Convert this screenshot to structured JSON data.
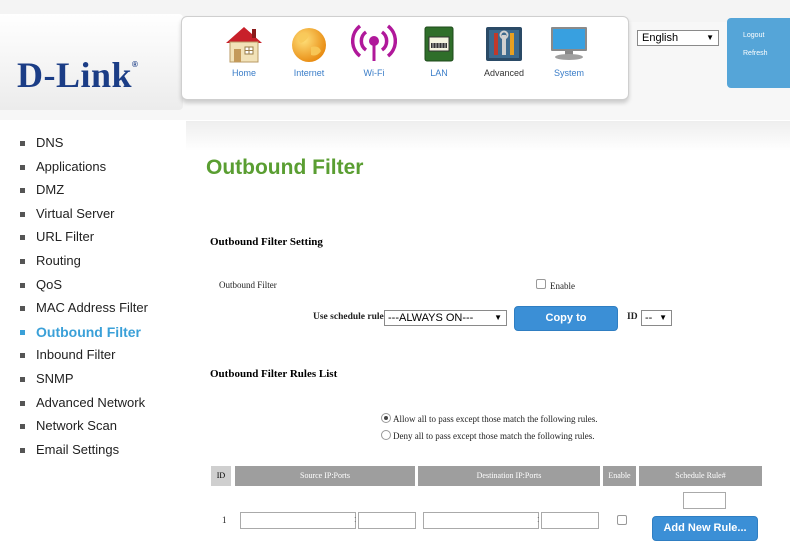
{
  "brand": {
    "logo_text": "D-Link",
    "logo_mark": "®",
    "color": "#1b3d86"
  },
  "nav": {
    "items": [
      {
        "label": "Home",
        "icon": "home-icon"
      },
      {
        "label": "Internet",
        "icon": "globe-icon"
      },
      {
        "label": "Wi-Fi",
        "icon": "wifi-icon"
      },
      {
        "label": "LAN",
        "icon": "lan-icon"
      },
      {
        "label": "Advanced",
        "icon": "tools-icon"
      },
      {
        "label": "System",
        "icon": "monitor-icon"
      }
    ],
    "active": "Advanced"
  },
  "language": {
    "selected": "English"
  },
  "side_panel": {
    "logout": "Logout",
    "refresh": "Refresh",
    "color": "#55a5d8"
  },
  "sidebar": {
    "items": [
      {
        "label": "DNS"
      },
      {
        "label": "Applications"
      },
      {
        "label": "DMZ"
      },
      {
        "label": "Virtual Server"
      },
      {
        "label": "URL Filter"
      },
      {
        "label": "Routing"
      },
      {
        "label": "QoS"
      },
      {
        "label": "MAC Address Filter"
      },
      {
        "label": "Outbound Filter"
      },
      {
        "label": "Inbound Filter"
      },
      {
        "label": "SNMP"
      },
      {
        "label": "Advanced Network"
      },
      {
        "label": "Network Scan"
      },
      {
        "label": "Email Settings"
      }
    ],
    "active_index": 8,
    "active_color": "#3aa0d8"
  },
  "page": {
    "title": "Outbound Filter",
    "title_color": "#5a9e32"
  },
  "setting": {
    "heading": "Outbound Filter Setting",
    "filter_label": "Outbound Filter",
    "enable_label": "Enable",
    "schedule_label": "Use schedule rule",
    "schedule_value": "---ALWAYS ON---",
    "copy_button": "Copy to",
    "id_label": "ID",
    "id_value": "--"
  },
  "rules": {
    "heading": "Outbound Filter Rules List",
    "option_allow": "Allow all to pass except those match the following rules.",
    "option_deny": "Deny all to pass except those match the following rules.",
    "selected": "allow",
    "columns": [
      "ID",
      "Source IP:Ports",
      "Destination IP:Ports",
      "Enable",
      "Schedule Rule#"
    ],
    "rows": [
      {
        "id": "1",
        "enabled": false
      }
    ],
    "add_button": "Add New Rule..."
  },
  "accent_button_color": "#3b8fd6"
}
